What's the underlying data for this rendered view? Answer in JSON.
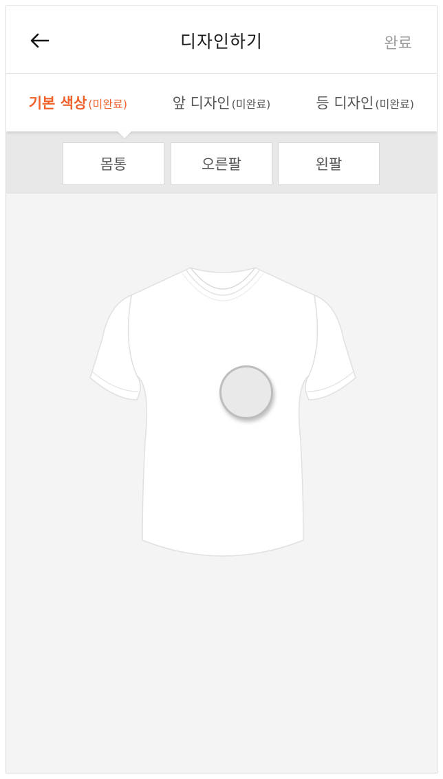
{
  "header": {
    "title": "디자인하기",
    "done_label": "완료"
  },
  "tabs": [
    {
      "label": "기본 색상",
      "status": "(미완료)"
    },
    {
      "label": "앞 디자인",
      "status": "(미완료)"
    },
    {
      "label": "등 디자인",
      "status": "(미완료)"
    }
  ],
  "parts": {
    "body": "몸통",
    "right_sleeve": "오른팔",
    "left_sleeve": "왼팔"
  },
  "colors": {
    "accent": "#f0622b",
    "background": "#f4f4f4"
  }
}
